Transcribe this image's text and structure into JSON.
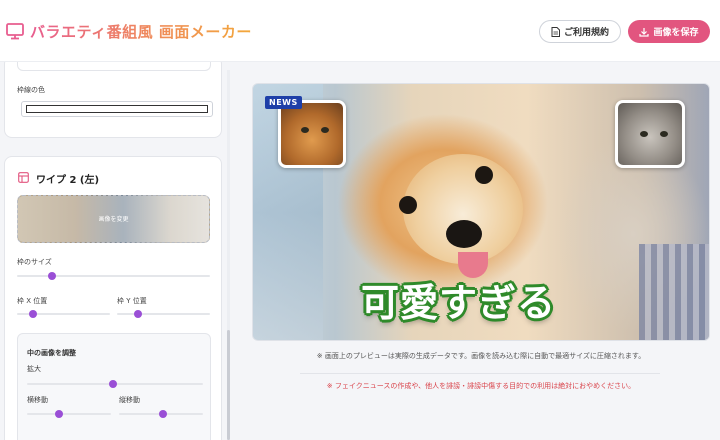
{
  "header": {
    "app_title": "バラエティ番組風 画面メーカー",
    "terms_label": "ご利用規約",
    "save_label": "画像を保存",
    "brand_color": "#e2557f"
  },
  "sidebar": {
    "border_color_label": "枠線の色",
    "wipe2": {
      "title": "ワイプ 2 (左)",
      "upload_text": "画像を変更",
      "frame_size_label": "枠のサイズ",
      "frame_size_value": 0.18,
      "frame_x_label": "枠 X 位置",
      "frame_x_value": 0.17,
      "frame_y_label": "枠 Y 位置",
      "frame_y_value": 0.23,
      "inner_adjust": {
        "title": "中の画像を調整",
        "zoom_label": "拡大",
        "zoom_value": 0.49,
        "horizontal_label": "横移動",
        "horizontal_value": 0.38,
        "vertical_label": "縦移動",
        "vertical_value": 0.52
      }
    }
  },
  "preview": {
    "badge": "NEWS",
    "telop": "可愛すぎる",
    "telop_outline_color": "#2f8a2a"
  },
  "notes": {
    "info": "※ 画面上のプレビューは実際の生成データです。画像を読み込む際に自動で最適サイズに圧縮されます。",
    "warning": "※ フェイクニュースの作成や、他人を誹謗・誹謗中傷する目的での利用は絶対におやめください。"
  }
}
